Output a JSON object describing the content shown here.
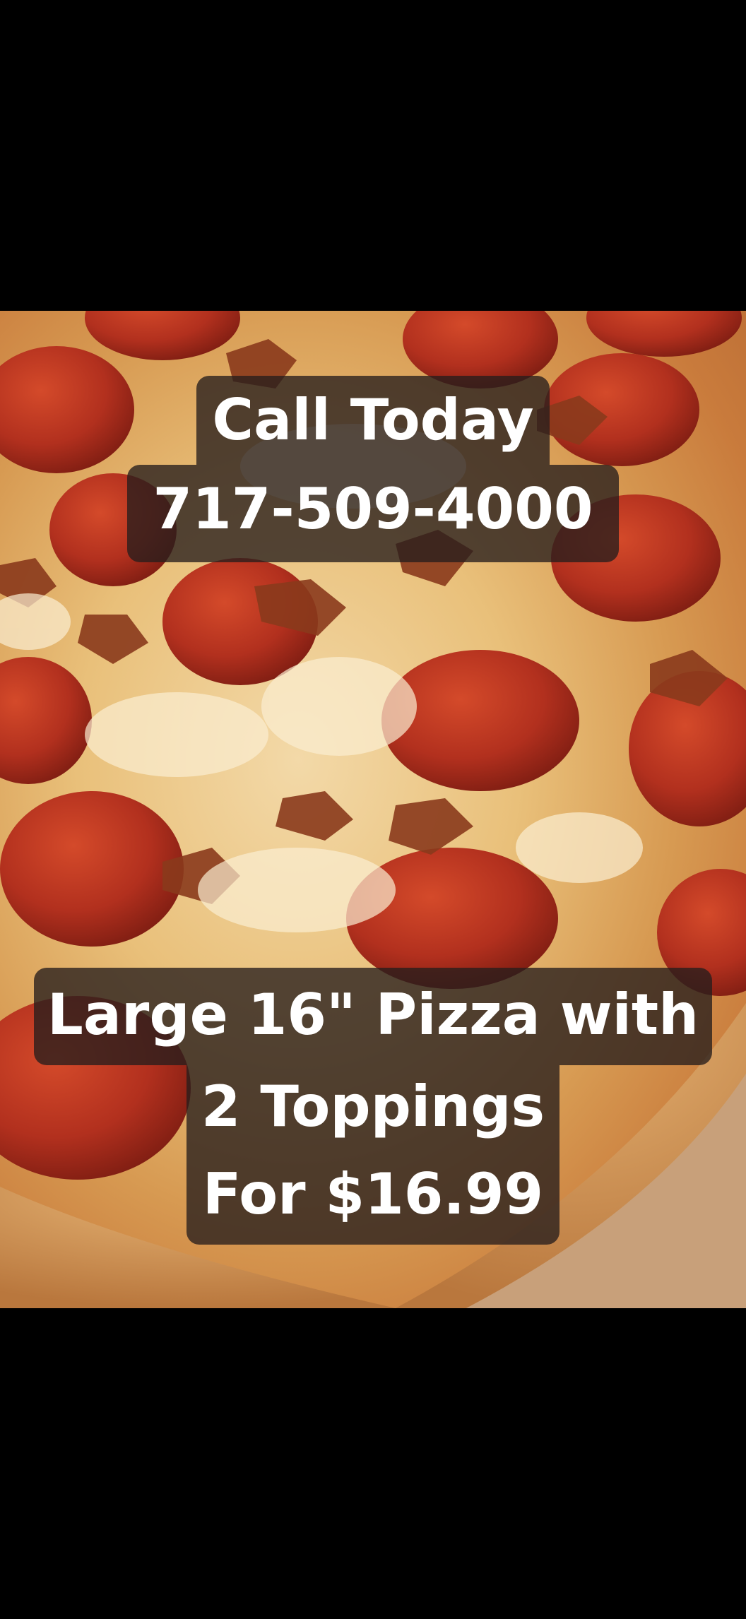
{
  "ad": {
    "call_line": "Call Today",
    "phone": "717-509-4000",
    "offer_line_1": "Large 16\" Pizza with",
    "offer_line_2": "2 Toppings",
    "offer_line_3": "For $16.99"
  },
  "colors": {
    "background": "#000000",
    "caption_bg": "#261e1c",
    "caption_text": "#ffffff",
    "pepperoni": "#b2301e",
    "cheese": "#f3d9a8",
    "crust": "#d69a5a"
  },
  "image": {
    "subject": "pepperoni-and-bacon-pizza-photo"
  }
}
